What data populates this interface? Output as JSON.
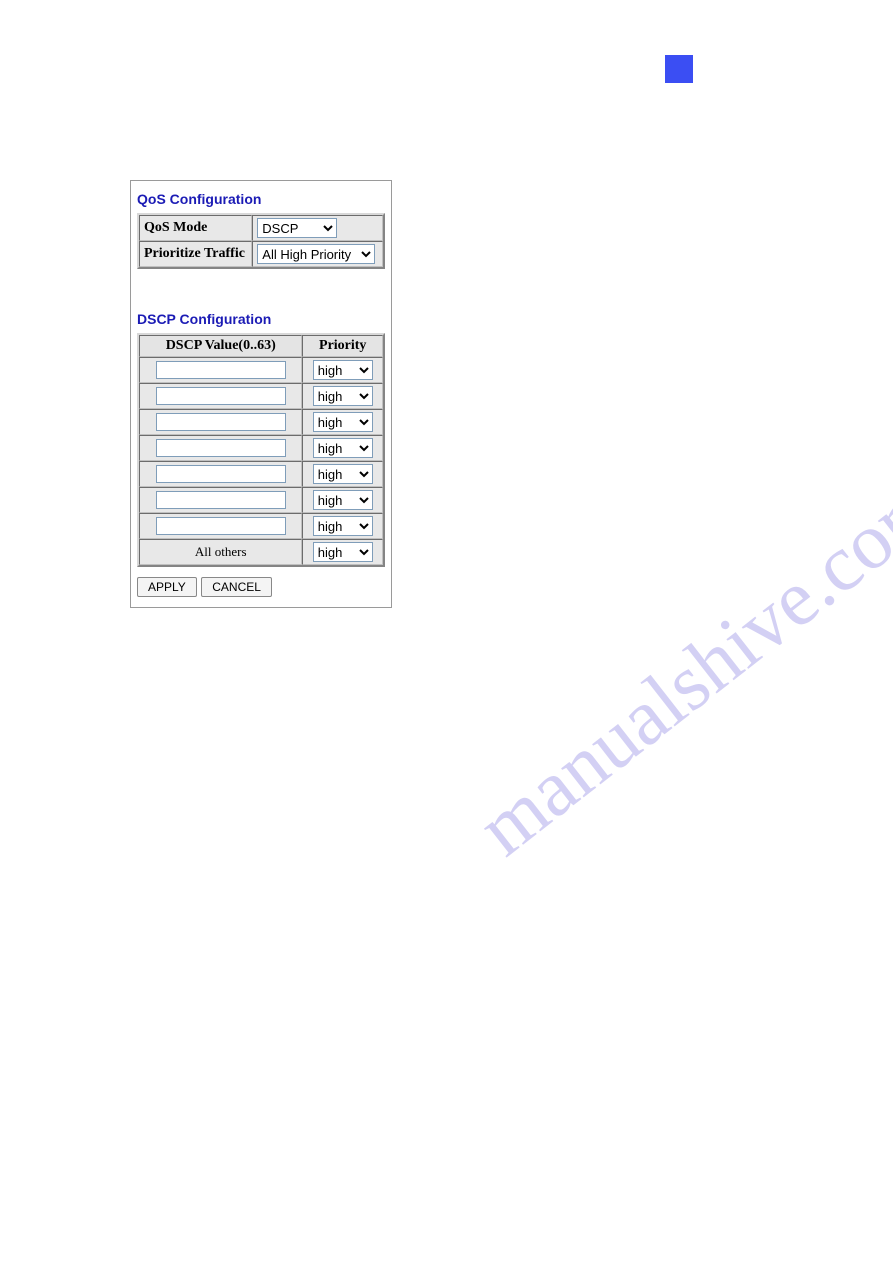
{
  "watermark": "manualshive.com",
  "qos": {
    "title": "QoS Configuration",
    "mode_label": "QoS Mode",
    "mode_value": "DSCP",
    "traffic_label": "Prioritize Traffic",
    "traffic_value": "All High Priority"
  },
  "dscp": {
    "title": "DSCP Configuration",
    "col_value": "DSCP Value(0..63)",
    "col_priority": "Priority",
    "rows": [
      {
        "value": "",
        "priority": "high"
      },
      {
        "value": "",
        "priority": "high"
      },
      {
        "value": "",
        "priority": "high"
      },
      {
        "value": "",
        "priority": "high"
      },
      {
        "value": "",
        "priority": "high"
      },
      {
        "value": "",
        "priority": "high"
      },
      {
        "value": "",
        "priority": "high"
      }
    ],
    "all_others_label": "All others",
    "all_others_priority": "high"
  },
  "buttons": {
    "apply": "APPLY",
    "cancel": "CANCEL"
  }
}
